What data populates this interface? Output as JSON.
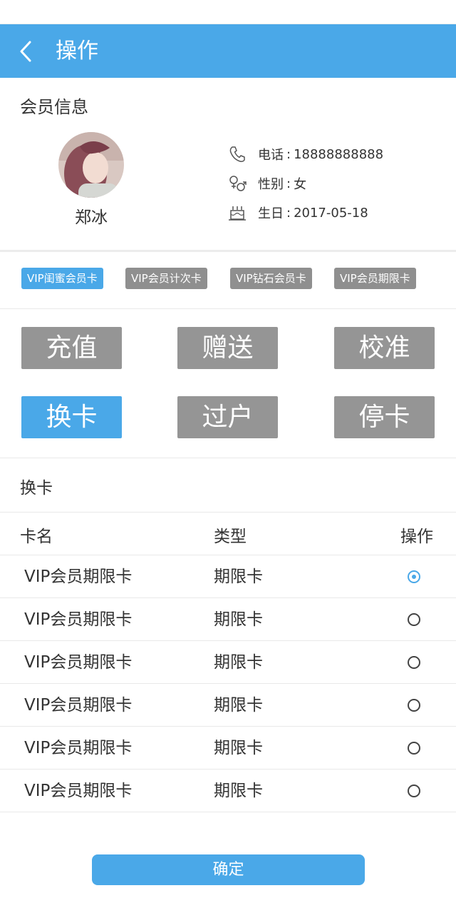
{
  "header": {
    "title": "操作",
    "back_icon": "chevron-left-icon"
  },
  "member": {
    "section_title": "会员信息",
    "name": "郑冰",
    "phone_label": "电话",
    "phone": "18888888888",
    "gender_label": "性别",
    "gender": "女",
    "birthday_label": "生日",
    "birthday": "2017-05-18",
    "separator": ":"
  },
  "cards": [
    {
      "label": "VIP闺蜜会员卡",
      "active": true
    },
    {
      "label": "VIP会员计次卡",
      "active": false
    },
    {
      "label": "VIP钻石会员卡",
      "active": false
    },
    {
      "label": "VIP会员期限卡",
      "active": false
    }
  ],
  "operations": [
    {
      "label": "充值",
      "active": false
    },
    {
      "label": "赠送",
      "active": false
    },
    {
      "label": "校准",
      "active": false
    },
    {
      "label": "换卡",
      "active": true
    },
    {
      "label": "过户",
      "active": false
    },
    {
      "label": "停卡",
      "active": false
    }
  ],
  "exchange": {
    "title": "换卡",
    "columns": [
      "卡名",
      "类型",
      "操作"
    ],
    "rows": [
      {
        "name": "VIP会员期限卡",
        "type": "期限卡",
        "selected": true
      },
      {
        "name": "VIP会员期限卡",
        "type": "期限卡",
        "selected": false
      },
      {
        "name": "VIP会员期限卡",
        "type": "期限卡",
        "selected": false
      },
      {
        "name": "VIP会员期限卡",
        "type": "期限卡",
        "selected": false
      },
      {
        "name": "VIP会员期限卡",
        "type": "期限卡",
        "selected": false
      },
      {
        "name": "VIP会员期限卡",
        "type": "期限卡",
        "selected": false
      }
    ]
  },
  "confirm_label": "确定",
  "colors": {
    "accent": "#4aa8e8",
    "inactive": "#959595"
  }
}
